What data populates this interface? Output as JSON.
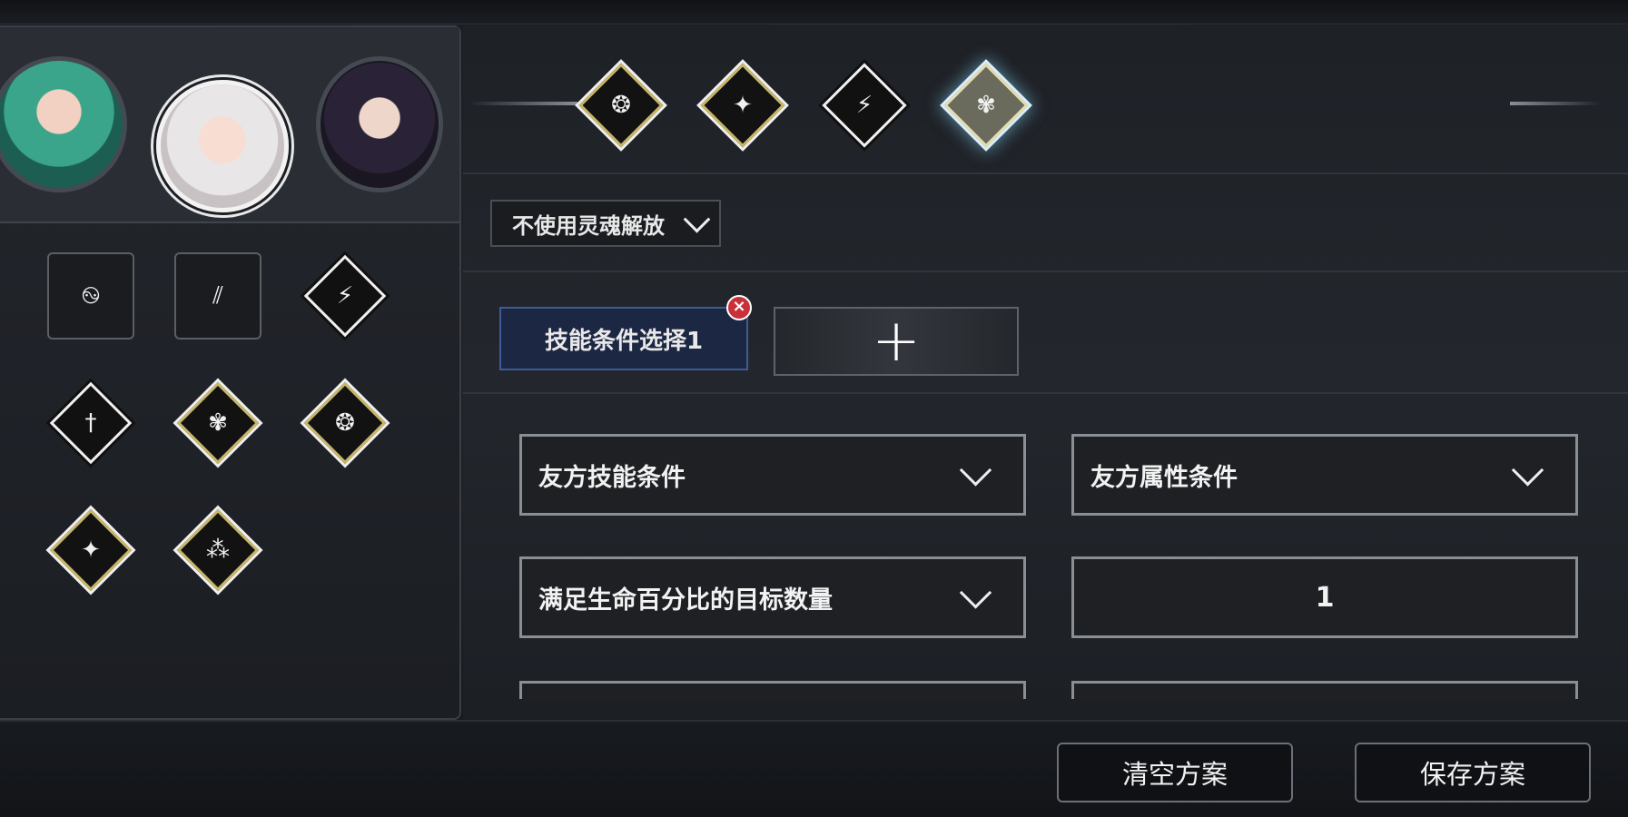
{
  "team": {
    "avatars": [
      {
        "name": "avatar-green-hair"
      },
      {
        "name": "avatar-white-hair",
        "selected": true
      },
      {
        "name": "avatar-dark-hair"
      }
    ]
  },
  "skill_grid": [
    {
      "icon": "swirl-icon",
      "style": "square"
    },
    {
      "icon": "claw-icon",
      "style": "square"
    },
    {
      "icon": "slash-icon",
      "style": "white"
    },
    {
      "icon": "sword-icon",
      "style": "white"
    },
    {
      "icon": "flower-icon",
      "style": "gold"
    },
    {
      "icon": "spiral-icon",
      "style": "gold"
    },
    {
      "icon": "stars-icon",
      "style": "gold"
    },
    {
      "icon": "constellation-icon",
      "style": "gold"
    }
  ],
  "skill_tabs": [
    {
      "icon": "spiral-icon",
      "active": false
    },
    {
      "icon": "stars-icon",
      "active": false
    },
    {
      "icon": "slash-icon",
      "active": false
    },
    {
      "icon": "flower-icon",
      "active": true
    }
  ],
  "soul_release": {
    "value": "不使用灵魂解放"
  },
  "conditions": {
    "tab_label": "技能条件选择1",
    "add_label": "+"
  },
  "fields": {
    "ally_skill": "友方技能条件",
    "ally_attr": "友方属性条件",
    "target_count": "满足生命百分比的目标数量",
    "count_value": "1"
  },
  "actions": {
    "clear": "清空方案",
    "save": "保存方案"
  },
  "colors": {
    "accent_gold": "#c7b66a",
    "active_glow": "#8cdcff",
    "delete_red": "#c8303a"
  }
}
